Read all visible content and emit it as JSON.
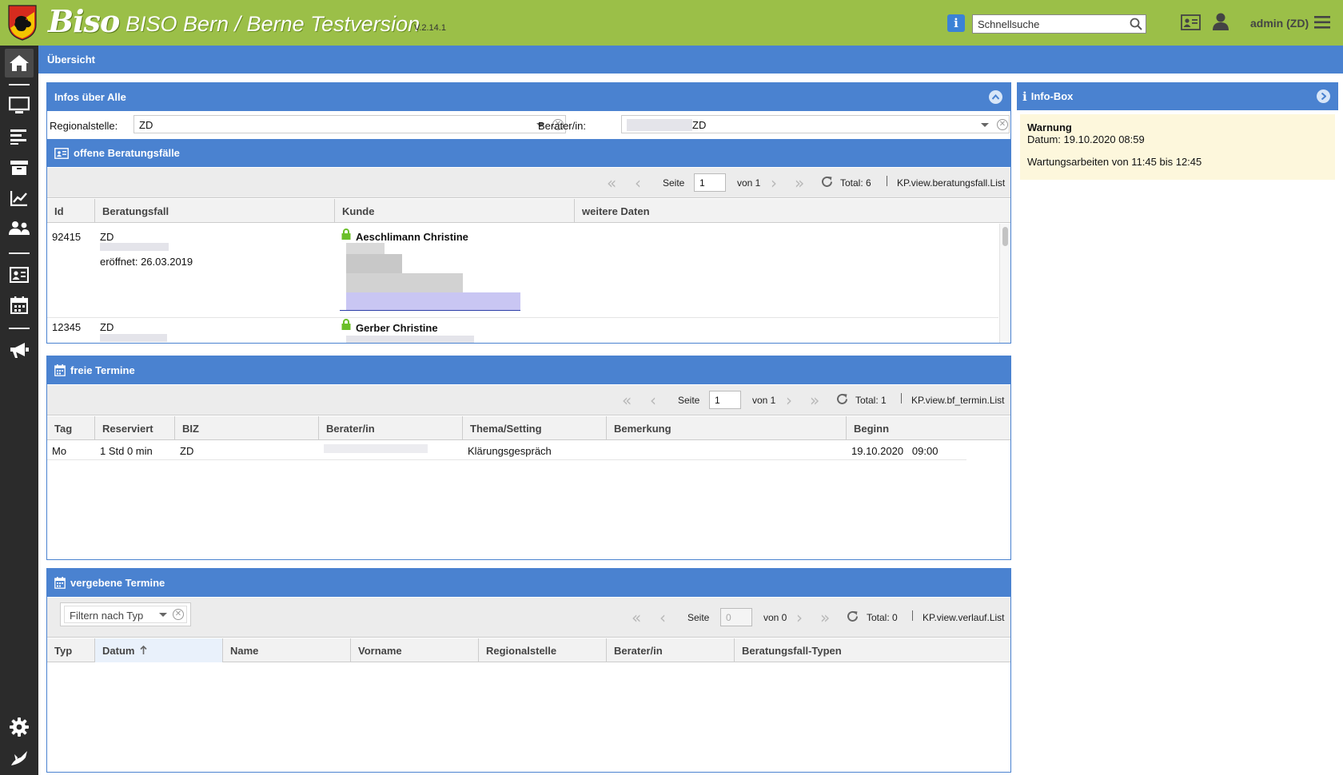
{
  "app": {
    "logo": "Biso",
    "title": "BISO Bern / Berne Testversion",
    "version": "V.2.14.1",
    "search_placeholder": "Schnellsuche",
    "user": "admin (ZD)"
  },
  "header": {
    "title": "Übersicht"
  },
  "infos_panel": {
    "title": "Infos über Alle",
    "regionalstelle_label": "Regionalstelle:",
    "regionalstelle_value": "ZD",
    "berater_label": "Berater/in:",
    "berater_value": "ZD"
  },
  "beratungsfaelle": {
    "title": "offene Beratungsfälle",
    "pager": {
      "seite_label": "Seite",
      "page": "1",
      "von": "von 1",
      "total": "Total: 6",
      "view": "KP.view.beratungsfall.List"
    },
    "columns": [
      "Id",
      "Beratungsfall",
      "Kunde",
      "weitere Daten"
    ],
    "rows": [
      {
        "id": "92415",
        "code": "ZD",
        "opened": "eröffnet: 26.03.2019",
        "kunde": "Aeschlimann Christine"
      },
      {
        "id": "12345",
        "code": "ZD",
        "kunde": "Gerber Christine"
      }
    ]
  },
  "freie_termine": {
    "title": "freie Termine",
    "pager": {
      "seite_label": "Seite",
      "page": "1",
      "von": "von 1",
      "total": "Total: 1",
      "view": "KP.view.bf_termin.List"
    },
    "columns": [
      "Tag",
      "Reserviert",
      "BIZ",
      "Berater/in",
      "Thema/Setting",
      "Bemerkung",
      "Beginn"
    ],
    "rows": [
      {
        "tag": "Mo",
        "reserviert": "1 Std 0 min",
        "biz": "ZD",
        "thema": "Klärungsgespräch",
        "beginn": "19.10.2020   09:00"
      }
    ]
  },
  "vergebene_termine": {
    "title": "vergebene Termine",
    "filter_placeholder": "Filtern nach Typ",
    "pager": {
      "seite_label": "Seite",
      "page": "0",
      "von": "von 0",
      "total": "Total: 0",
      "view": "KP.view.verlauf.List"
    },
    "columns": [
      "Typ",
      "Datum",
      "Name",
      "Vorname",
      "Regionalstelle",
      "Berater/in",
      "Beratungsfall-Typen"
    ]
  },
  "infobox": {
    "title": "Info-Box",
    "warning_title": "Warnung",
    "warning_date": "Datum: 19.10.2020 08:59",
    "warning_text": "Wartungsarbeiten von 11:45 bis 12:45"
  },
  "icons": {
    "sidebar": [
      "home-icon",
      "monitor-icon",
      "list-icon",
      "archive-icon",
      "chart-icon",
      "users-icon",
      "id-card-icon",
      "calendar-icon",
      "megaphone-icon",
      "gear-icon",
      "logo-icon"
    ]
  },
  "colors": {
    "topbar": "#9bbf48",
    "accent": "#4a82d0",
    "sidebar": "#2b2b2b",
    "lock": "#6bbf2a",
    "infobox_bg": "#fdf7dc"
  }
}
